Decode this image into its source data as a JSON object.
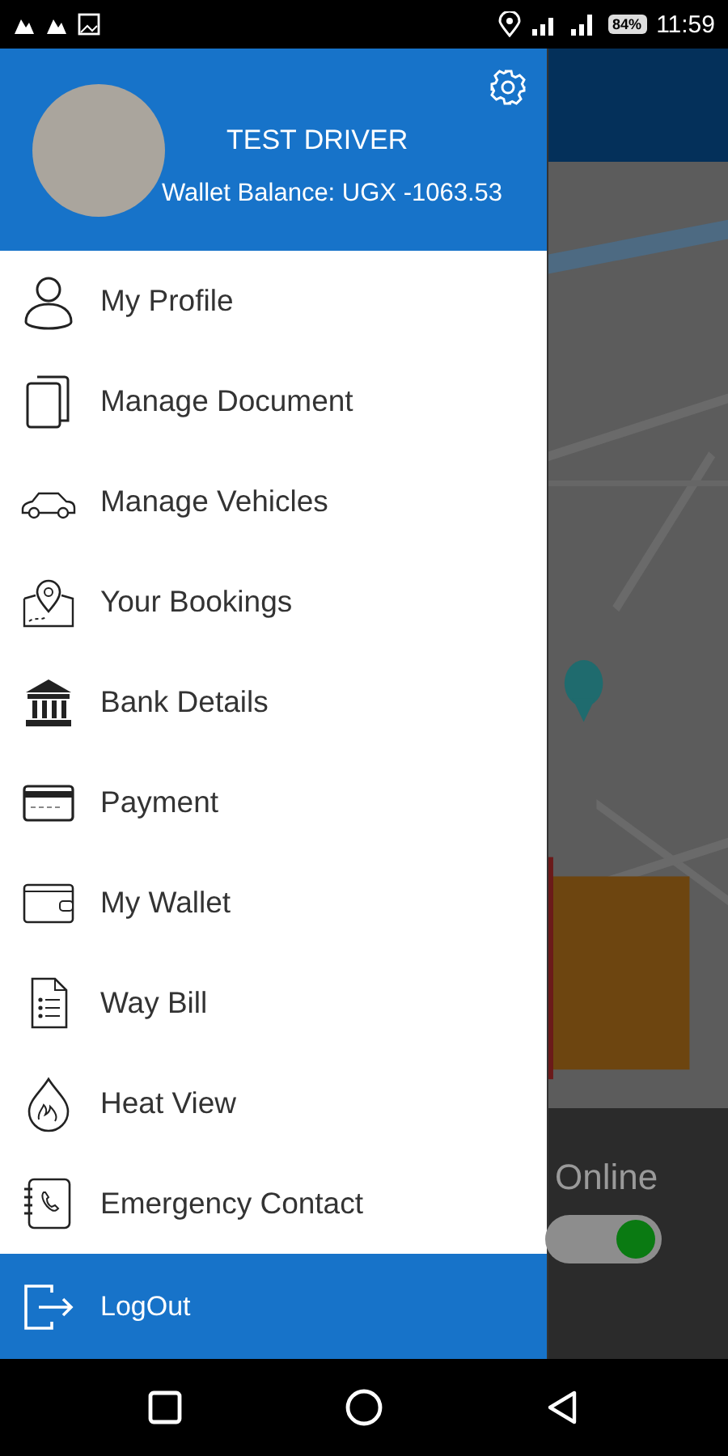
{
  "status_bar": {
    "battery": "84%",
    "time": "11:59"
  },
  "drawer": {
    "header": {
      "name": "TEST DRIVER",
      "wallet_balance": "Wallet Balance: UGX -1063.53"
    },
    "items": [
      {
        "label": "My Profile"
      },
      {
        "label": "Manage Document"
      },
      {
        "label": "Manage Vehicles"
      },
      {
        "label": "Your Bookings"
      },
      {
        "label": "Bank Details"
      },
      {
        "label": "Payment"
      },
      {
        "label": "My Wallet"
      },
      {
        "label": "Way Bill"
      },
      {
        "label": "Heat View"
      },
      {
        "label": "Emergency Contact"
      }
    ],
    "logout": {
      "label": "LogOut"
    }
  },
  "online_panel": {
    "label": "Online",
    "on": true
  }
}
